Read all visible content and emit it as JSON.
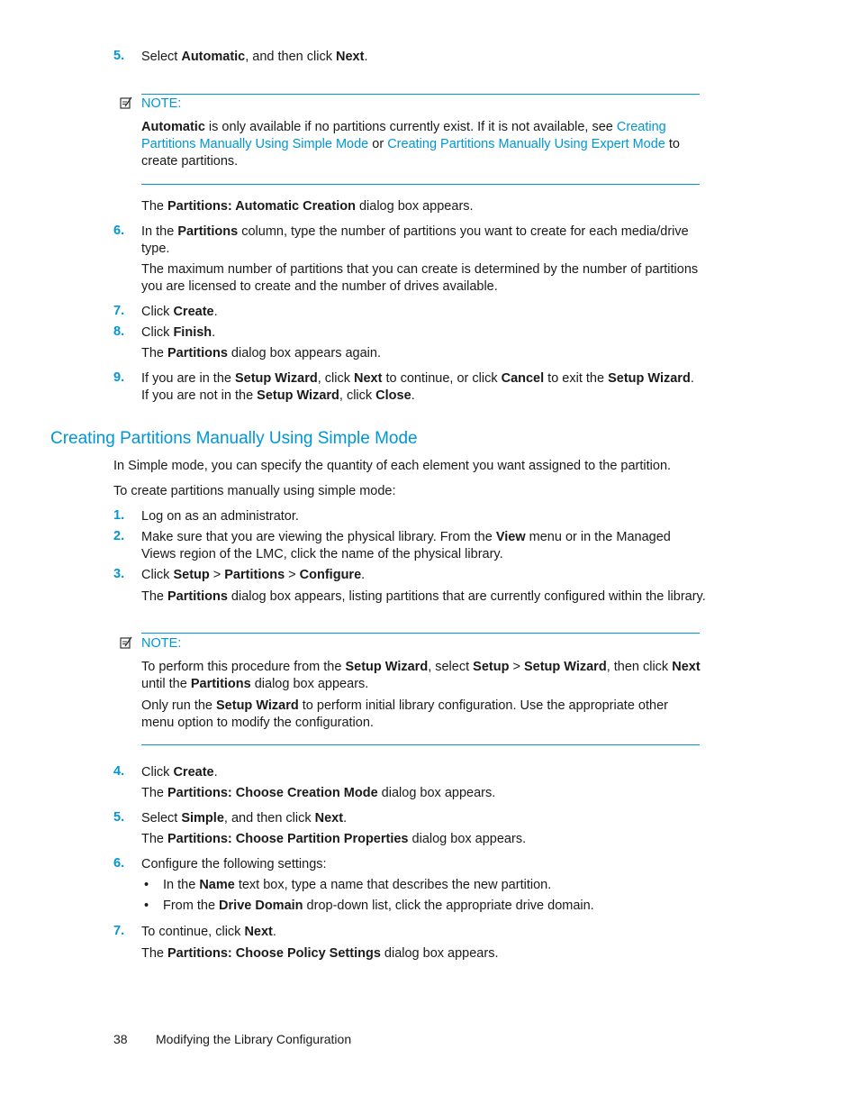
{
  "colors": {
    "accent": "#0096d6",
    "text": "#1a1a1a"
  },
  "top_steps": {
    "s5": {
      "num": "5.",
      "pre": "Select ",
      "b1": "Automatic",
      "mid": ", and then click ",
      "b2": "Next",
      "post": "."
    },
    "note1": {
      "label": "NOTE:",
      "icon": "note-pencil-icon",
      "b1": "Automatic",
      "t1": " is only available if no partitions currently exist. If it is not available, see ",
      "link1a": "Creating",
      "link1b": "Partitions Manually Using Simple Mode",
      "t2": " or ",
      "link2": "Creating Partitions Manually Using Expert Mode",
      "t3": " to",
      "t4": "create partitions."
    },
    "after_note": {
      "pre": "The ",
      "b": "Partitions: Automatic Creation",
      "post": " dialog box appears."
    },
    "s6": {
      "num": "6.",
      "pre": "In the ",
      "b": "Partitions",
      "post": " column, type the number of partitions you want to create for each media/drive",
      "line2": "type.",
      "para1": "The maximum number of partitions that you can create is determined by the number of partitions",
      "para2": "you are licensed to create and the number of drives available."
    },
    "s7": {
      "num": "7.",
      "pre": "Click ",
      "b": "Create",
      "post": "."
    },
    "s8": {
      "num": "8.",
      "pre": "Click ",
      "b": "Finish",
      "post": ".",
      "sub_pre": "The ",
      "sub_b": "Partitions",
      "sub_post": " dialog box appears again."
    },
    "s9": {
      "num": "9.",
      "t1": "If you are in the ",
      "b1": "Setup Wizard",
      "t2": ", click ",
      "b2": "Next",
      "t3": " to continue, or click ",
      "b3": "Cancel",
      "t4": " to exit the ",
      "b4": "Setup Wizard",
      "t5": ".",
      "l2_t1": "If you are not in the ",
      "l2_b1": "Setup Wizard",
      "l2_t2": ", click ",
      "l2_b2": "Close",
      "l2_t3": "."
    }
  },
  "section": {
    "heading": "Creating Partitions Manually Using Simple Mode",
    "intro1": "In Simple mode, you can specify the quantity of each element you want assigned to the partition.",
    "intro2": "To create partitions manually using simple mode:",
    "s1": {
      "num": "1.",
      "text": "Log on as an administrator."
    },
    "s2": {
      "num": "2.",
      "pre": "Make sure that you are viewing the physical library. From the ",
      "b": "View",
      "post": " menu or in the Managed",
      "line2": "Views region of the LMC, click the name of the physical library."
    },
    "s3": {
      "num": "3.",
      "pre": "Click ",
      "b1": "Setup",
      "sep1": " > ",
      "b2": "Partitions",
      "sep2": " > ",
      "b3": "Configure",
      "post": ".",
      "sub_pre": "The ",
      "sub_b": "Partitions",
      "sub_post": " dialog box appears, listing partitions that are currently configured within the library."
    },
    "note2": {
      "label": "NOTE:",
      "icon": "note-pencil-icon",
      "t1": "To perform this procedure from the ",
      "b1": "Setup Wizard",
      "t2": ", select ",
      "b2": "Setup",
      "t3": " > ",
      "b3": "Setup Wizard",
      "t4": ", then click ",
      "b4": "Next",
      "l2_t1": "until the ",
      "l2_b": "Partitions",
      "l2_t2": " dialog box appears.",
      "p2_t1": "Only run the ",
      "p2_b": "Setup Wizard",
      "p2_t2": " to perform initial library configuration. Use the appropriate other",
      "p2_l2": "menu option to modify the configuration."
    },
    "s4": {
      "num": "4.",
      "pre": "Click ",
      "b": "Create",
      "post": ".",
      "sub_pre": "The ",
      "sub_b": "Partitions: Choose Creation Mode",
      "sub_post": " dialog box appears."
    },
    "s5": {
      "num": "5.",
      "pre": "Select ",
      "b1": "Simple",
      "mid": ", and then click ",
      "b2": "Next",
      "post": ".",
      "sub_pre": "The ",
      "sub_b": "Partitions: Choose Partition Properties",
      "sub_post": " dialog box appears."
    },
    "s6": {
      "num": "6.",
      "text": "Configure the following settings:",
      "bullets": [
        {
          "pre": "In the ",
          "b": "Name",
          "post": " text box, type a name that describes the new partition."
        },
        {
          "pre": "From the ",
          "b": "Drive Domain",
          "post": " drop-down list, click the appropriate drive domain."
        }
      ]
    },
    "s7": {
      "num": "7.",
      "pre": "To continue, click ",
      "b": "Next",
      "post": ".",
      "sub_pre": "The ",
      "sub_b": "Partitions: Choose Policy Settings",
      "sub_post": " dialog box appears."
    }
  },
  "footer": {
    "page_number": "38",
    "title": "Modifying the Library Configuration"
  }
}
